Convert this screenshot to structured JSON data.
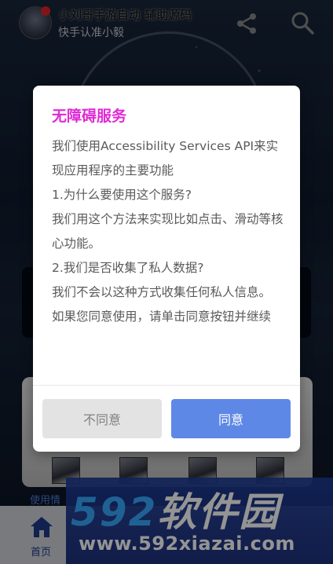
{
  "header": {
    "app_name": "小刘哥手游自动 辅助源码",
    "subtitle": "快手认准小毅"
  },
  "icons": {
    "share": "share-icon",
    "search": "search-icon",
    "home": "home-icon"
  },
  "content": {
    "usage_label": "使用情"
  },
  "bottom_nav": {
    "home_label": "首页"
  },
  "watermark": {
    "brand_numbers": "592",
    "brand_text": "软件园",
    "url": "www.592xiazai.com"
  },
  "dialog": {
    "title": "无障碍服务",
    "lines": [
      "我们使用Accessibility Services API来实现应用程序的主要功能",
      "1.为什么要使用这个服务?",
      "我们用这个方法来实现比如点击、滑动等核心功能。",
      "2.我们是否收集了私人数据?",
      "我们不会以这种方式收集任何私人信息。",
      "如果您同意使用，请单击同意按钮并继续"
    ],
    "disagree_label": "不同意",
    "agree_label": "同意"
  },
  "colors": {
    "title_accent": "#e02ad6",
    "agree_button": "#5e88e6",
    "disagree_button": "#e3e3e3"
  }
}
